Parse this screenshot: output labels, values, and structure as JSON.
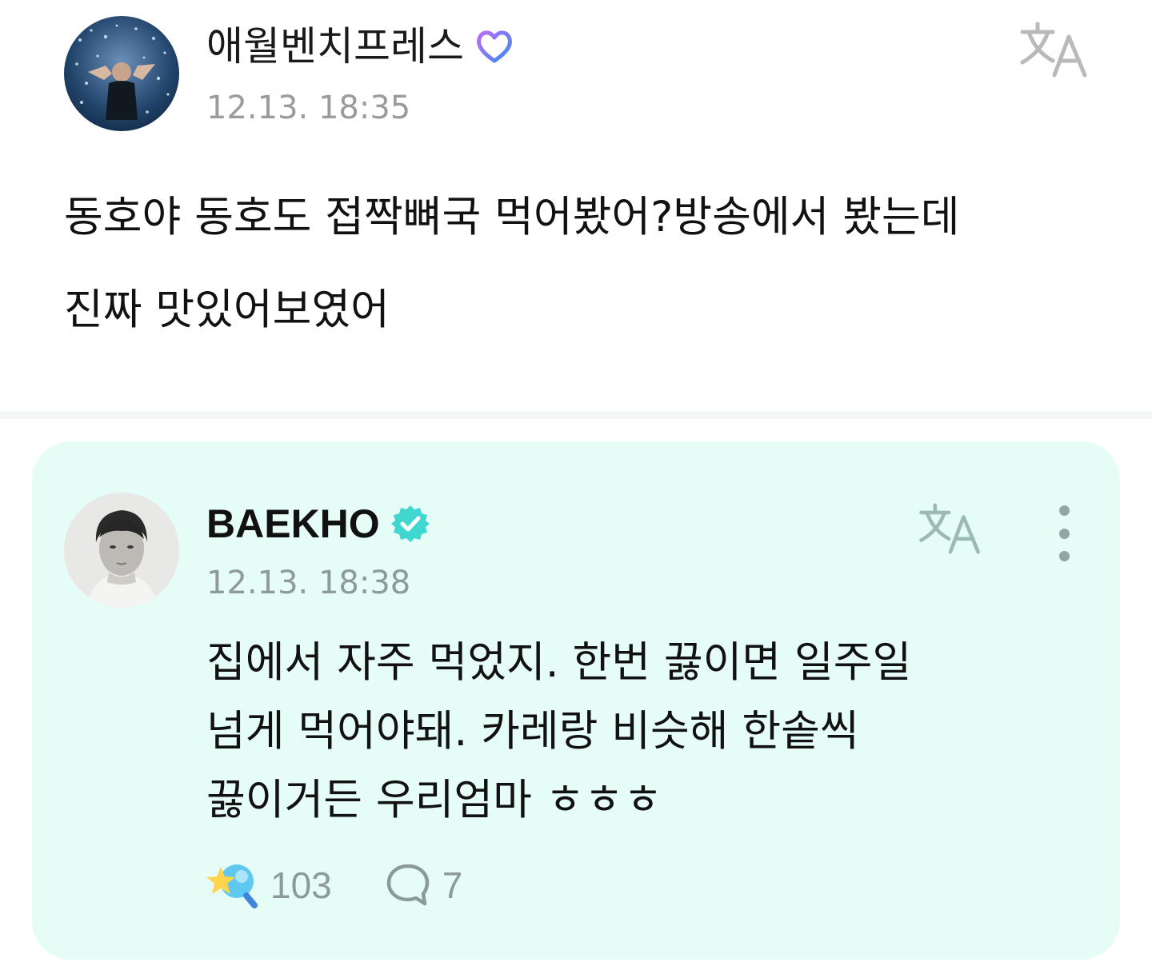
{
  "post": {
    "author": "애월벤치프레스",
    "timestamp": "12.13. 18:35",
    "body": "동호야 동호도 접짝뼈국 먹어봤어?방송에서 봤는데\n진짜 맛있어보였어"
  },
  "reply": {
    "author": "BAEKHO",
    "timestamp": "12.13. 18:38",
    "body": "집에서 자주 먹었지. 한번 끓이면 일주일\n넘게 먹어야돼. 카레랑 비슷해 한솥씩\n끓이거든 우리엄마 ㅎㅎㅎ",
    "like_count": "103",
    "comment_count": "7"
  },
  "colors": {
    "card_background": "#e6fcf7",
    "verified_badge": "#3fd7cf",
    "fan_badge": "#5b7cf5",
    "muted_text": "#9b9b9b"
  },
  "icons": {
    "fan_badge": "heart-badge-icon",
    "verified_badge": "verified-check-icon",
    "translate": "translate-icon",
    "more": "more-vertical-icon",
    "like": "star-reaction-icon",
    "comment": "comment-bubble-icon"
  }
}
